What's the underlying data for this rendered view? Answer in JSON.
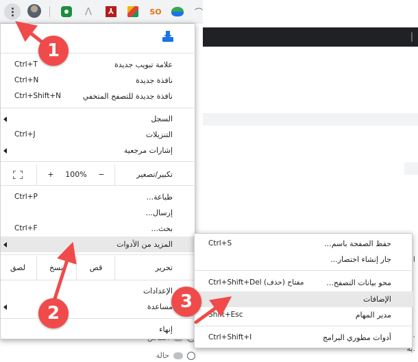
{
  "colors": {
    "accent": "#1a73e8",
    "annotation": "#f04a4a",
    "highlight": "#e8e8e8",
    "dark_band": "#202124"
  },
  "toolbar": {
    "menu_button_icon": "three-dots-vertical-icon",
    "extension_icons": [
      "avatar",
      "shield-extension-icon",
      "acrobat-logo-icon",
      "adobe-pdf-icon",
      "google-forms-icon",
      "seo-extension-icon",
      "idm-extension-icon",
      "puzzle-icon"
    ],
    "ext_seo_label": "SO"
  },
  "main_menu": {
    "install_icon": "install-app-icon",
    "items": [
      {
        "label": "علامة تبويب جديدة",
        "shortcut": "Ctrl+T"
      },
      {
        "label": "نافذة جديدة",
        "shortcut": "Ctrl+N"
      },
      {
        "label": "نافذة  جديدة للتصفح المتخفي",
        "shortcut": "Ctrl+Shift+N"
      },
      {
        "label": "السجل",
        "shortcut": ""
      },
      {
        "label": "التنزيلات",
        "shortcut": "Ctrl+J"
      },
      {
        "label": "إشارات مرجعية",
        "shortcut": ""
      }
    ],
    "zoom": {
      "label": "تكبير/تصغير",
      "minus": "−",
      "value": "100%",
      "plus": "+"
    },
    "items2": [
      {
        "label": "طباعة...",
        "shortcut": "Ctrl+P"
      },
      {
        "label": "إرسال...",
        "shortcut": ""
      },
      {
        "label": "بحث...",
        "shortcut": "Ctrl+F"
      },
      {
        "label": "المزيد من الأدوات",
        "shortcut": ""
      }
    ],
    "edit": {
      "label": "تحرير",
      "cut": "قص",
      "copy": "نسخ",
      "paste": "لصق"
    },
    "items3": [
      {
        "label": "الإعدادات",
        "shortcut": ""
      },
      {
        "label": "مساعدة",
        "shortcut": ""
      },
      {
        "label": "إنهاء",
        "shortcut": ""
      }
    ]
  },
  "sub_menu": {
    "items": [
      {
        "label": "حفظ الصفحة باسم...",
        "shortcut": "Ctrl+S"
      },
      {
        "label": "جار إنشاء اختصار...",
        "shortcut": ""
      },
      {
        "label": "محو بيانات التصفح...",
        "shortcut": "Ctrl+Shift+Del مفتاح (حذف)"
      },
      {
        "label": "الإضافات",
        "shortcut": ""
      },
      {
        "label": "مدير المهام",
        "shortcut": "Shift+Esc"
      },
      {
        "label": "أدوات مطوري البرامج",
        "shortcut": "Ctrl+Shift+I"
      }
    ]
  },
  "page": {
    "fragments": [
      "الأ",
      "ة.",
      "ية."
    ],
    "options": [
      "اقتباس",
      "حالة"
    ]
  },
  "annotations": {
    "step1": "1",
    "step2": "2",
    "step3": "3"
  }
}
